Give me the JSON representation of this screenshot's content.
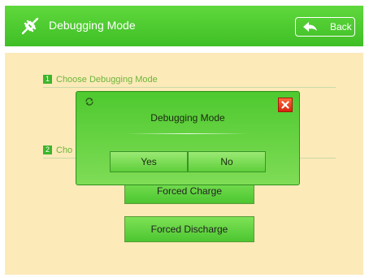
{
  "header": {
    "title": "Debugging Mode",
    "back_label": "Back",
    "app_icon": "debug-plug-icon",
    "back_icon": "back-arrow-icon"
  },
  "steps": [
    {
      "num": "1",
      "label": "Choose Debugging Mode"
    },
    {
      "num": "2",
      "label": "Cho"
    }
  ],
  "mode_buttons": {
    "charge_label": "Forced Charge",
    "discharge_label": "Forced Discharge"
  },
  "dialog": {
    "title": "Debugging Mode",
    "yes_label": "Yes",
    "no_label": "No",
    "refresh_icon": "refresh-icon",
    "close_icon": "close-icon"
  },
  "colors": {
    "accent_green": "#3fbf26",
    "content_bg": "#fdeab9",
    "close_red": "#d5260e"
  }
}
